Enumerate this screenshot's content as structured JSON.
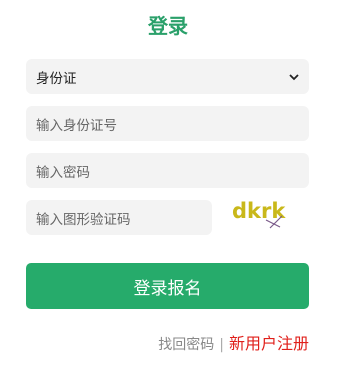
{
  "title": "登录",
  "id_type": {
    "selected": "身份证"
  },
  "inputs": {
    "id_placeholder": "输入身份证号",
    "password_placeholder": "输入密码",
    "captcha_placeholder": "输入图形验证码"
  },
  "captcha_text": "dkrk",
  "login_button": "登录报名",
  "links": {
    "recover": "找回密码",
    "separator": "|",
    "register": "新用户注册"
  },
  "colors": {
    "accent": "#26ab6b",
    "title": "#2aa06a",
    "register": "#e0201b",
    "captcha": "#c9b81a"
  }
}
